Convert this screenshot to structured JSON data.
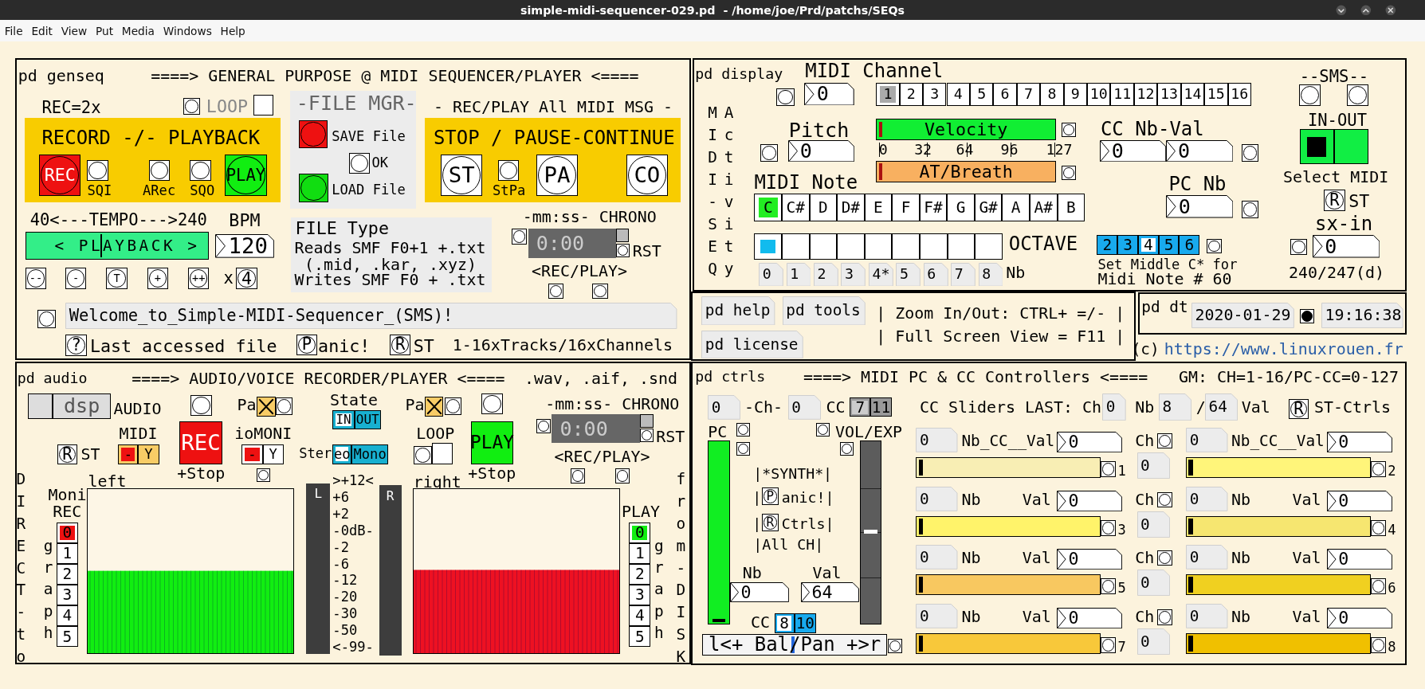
{
  "window": {
    "title": "simple-midi-sequencer-029.pd  - /home/joe/Prd/patchs/SEQs"
  },
  "menu": [
    "File",
    "Edit",
    "View",
    "Put",
    "Media",
    "Windows",
    "Help"
  ],
  "genseq": {
    "title": "pd genseq",
    "heading": "====> GENERAL PURPOSE @ MIDI SEQUENCER/PLAYER <====",
    "rec_mode": "REC=2x",
    "loop": {
      "label": "LOOP",
      "checked": false
    },
    "record_title": "RECORD -/- PLAYBACK",
    "rec_button": "REC",
    "sqi": "SQI",
    "arec": "ARec",
    "sqo": "SQO",
    "play_button": "PLAY",
    "file_mgr": "-FILE MGR-",
    "save": "SAVE File",
    "ok": "OK",
    "load": "LOAD File",
    "msg_heading": "- REC/PLAY All MIDI MSG -",
    "stop_title": "STOP / PAUSE-CONTINUE",
    "st": "ST",
    "stpa": "StPa",
    "pa": "PA",
    "co": "CO",
    "tempo_range": "40<---TEMPO--->240",
    "bpm_label": "BPM",
    "tempo_slider": {
      "label": "< PLAYBACK >",
      "level": 0.41
    },
    "bpm": "120",
    "tempo_buttons": [
      "--",
      "-",
      "T",
      "+",
      "++"
    ],
    "times": "x",
    "multiplier": "4",
    "file_type": "FILE Type",
    "file_lines": [
      "Reads SMF F0+1 +.txt",
      "(.mid, .kar, .xyz)",
      "Writes SMF F0 + .txt"
    ],
    "chrono": {
      "heading": "-mm:ss- CHRONO",
      "time": "0:00",
      "reset": "RST",
      "recplay": "<REC/PLAY>"
    },
    "message": "Welcome_to_Simple-MIDI-Sequencer_(SMS)!",
    "help_mark": "?",
    "last_file": "Last accessed file",
    "panic_mark": "P",
    "panic": "anic!",
    "reset_mark": "R",
    "reset": "ST",
    "tracks": "1-16xTracks/16xChannels"
  },
  "display": {
    "title": "pd display",
    "channel_label": "MIDI Channel",
    "channel_number": "0",
    "channels": [
      {
        "label": "1",
        "selected": true
      },
      {
        "label": "2",
        "selected": false
      },
      {
        "label": "3",
        "selected": false
      },
      {
        "label": "4",
        "selected": false
      },
      {
        "label": "5",
        "selected": false
      },
      {
        "label": "6",
        "selected": false
      },
      {
        "label": "7",
        "selected": false
      },
      {
        "label": "8",
        "selected": false
      },
      {
        "label": "9",
        "selected": false
      },
      {
        "label": "10",
        "selected": false
      },
      {
        "label": "11",
        "selected": false
      },
      {
        "label": "12",
        "selected": false
      },
      {
        "label": "13",
        "selected": false
      },
      {
        "label": "14",
        "selected": false
      },
      {
        "label": "15",
        "selected": false
      },
      {
        "label": "16",
        "selected": false
      }
    ],
    "sms": "--SMS--",
    "side1": "MIDI-SEQ",
    "side2": "Activity",
    "pitch_label": "Pitch",
    "pitch": "0",
    "velocity": {
      "label": "Velocity",
      "level": 0
    },
    "scale": [
      "0",
      "32",
      "64",
      "96",
      "127"
    ],
    "breath": {
      "label": "AT/Breath",
      "level": 0
    },
    "cc_label": "CC Nb-Val",
    "cc_nb": "0",
    "cc_val": "0",
    "note_label": "MIDI Note",
    "notes": [
      {
        "label": "C",
        "selected": true
      },
      {
        "label": "C#",
        "selected": false
      },
      {
        "label": "D",
        "selected": false
      },
      {
        "label": "D#",
        "selected": false
      },
      {
        "label": "E",
        "selected": false
      },
      {
        "label": "F",
        "selected": false
      },
      {
        "label": "F#",
        "selected": false
      },
      {
        "label": "G",
        "selected": false
      },
      {
        "label": "G#",
        "selected": false
      },
      {
        "label": "A",
        "selected": false
      },
      {
        "label": "A#",
        "selected": false
      },
      {
        "label": "B",
        "selected": false
      }
    ],
    "pc_label": "PC Nb",
    "pc": "0",
    "inout_label": "IN-OUT",
    "inout": [
      {
        "selected": true
      },
      {
        "selected": false
      }
    ],
    "select_midi": "Select MIDI",
    "st_mark": "R",
    "st": "ST",
    "sx_label": "sx-in",
    "sx": "0",
    "sx_note": "240/247(d)",
    "octaves": [
      {
        "selected": true
      },
      {
        "selected": false
      },
      {
        "selected": false
      },
      {
        "selected": false
      },
      {
        "selected": false
      },
      {
        "selected": false
      },
      {
        "selected": false
      },
      {
        "selected": false
      },
      {
        "selected": false
      }
    ],
    "octave_label": "OCTAVE",
    "octave_numbers": [
      "0",
      "1",
      "2",
      "3",
      "4*",
      "5",
      "6",
      "7",
      "8"
    ],
    "nb": "Nb",
    "middle": [
      {
        "label": "2",
        "selected": false
      },
      {
        "label": "3",
        "selected": false
      },
      {
        "label": "4",
        "selected": true
      },
      {
        "label": "5",
        "selected": false
      },
      {
        "label": "6",
        "selected": false
      }
    ],
    "middle_note": [
      "Set Middle C* for",
      "Midi Note # 60"
    ]
  },
  "help": {
    "buttons": [
      "pd help",
      "pd tools",
      "pd license"
    ],
    "lines": [
      "| Zoom In/Out: CTRL+ =/- |",
      "| Full Screen View = F11 |"
    ]
  },
  "dt": {
    "title": "pd dt",
    "date": "2020-01-29",
    "time": "19:16:38"
  },
  "copyright": "(c)",
  "link": "https://www.linuxrouen.fr",
  "audio": {
    "title": "pd audio",
    "heading": "====> AUDIO/VOICE RECORDER/PLAYER <====",
    "formats": ".wav, .aif, .snd",
    "dsp": {
      "label": "dsp",
      "checked": false
    },
    "audio_label": "AUDIO",
    "pause_in": {
      "label": "Pa",
      "checked": true
    },
    "state_label": "State",
    "state": [
      {
        "label": "IN",
        "selected": true
      },
      {
        "label": "OUT",
        "selected": false
      }
    ],
    "midi_label": "MIDI",
    "midi": [
      {
        "label": "-",
        "selected": true
      },
      {
        "label": "Y",
        "selected": false
      }
    ],
    "st_mark": "R",
    "st": "ST",
    "rec_button": "REC",
    "rec_stop": "+Stop",
    "iomoni_label": "ioMONI",
    "iomoni": [
      {
        "label": "-",
        "selected": true
      },
      {
        "label": "Y",
        "selected": false
      }
    ],
    "stereo_label": "Ster",
    "stereo": [
      {
        "label": "eo",
        "selected": true
      },
      {
        "label": "Mono",
        "selected": false
      }
    ],
    "pause_out": {
      "label": "Pa",
      "checked": true
    },
    "loop": {
      "label": "LOOP",
      "checked": false
    },
    "play_button": "PLAY",
    "play_stop": "+Stop",
    "chrono": {
      "heading": "-mm:ss- CHRONO",
      "time": "0:00",
      "reset": "RST",
      "recplay": "<REC/PLAY>"
    },
    "direct": "DIRECT-to",
    "graph_left": "graph",
    "moni": "Moni",
    "rec_label": "REC",
    "rec_graphs": [
      {
        "label": "0",
        "selected": true
      },
      {
        "label": "1",
        "selected": false
      },
      {
        "label": "2",
        "selected": false
      },
      {
        "label": "3",
        "selected": false
      },
      {
        "label": "4",
        "selected": false
      },
      {
        "label": "5",
        "selected": false
      }
    ],
    "left": "left",
    "vu_left": "L",
    "vu_scale": [
      ">+12<",
      "+6",
      "+2",
      "-0dB-",
      "-2",
      "-6",
      "-12",
      "-20",
      "-30",
      "-50",
      "<-99-"
    ],
    "vu_right": "R",
    "right": "right",
    "play_label": "PLAY",
    "play_graphs": [
      {
        "label": "0",
        "selected": true
      },
      {
        "label": "1",
        "selected": false
      },
      {
        "label": "2",
        "selected": false
      },
      {
        "label": "3",
        "selected": false
      },
      {
        "label": "4",
        "selected": false
      },
      {
        "label": "5",
        "selected": false
      }
    ],
    "graph_right": "graph",
    "disk": "from-DISK"
  },
  "ctrls": {
    "title": "pd ctrls",
    "heading": "====> MIDI PC & CC Controllers <====",
    "gm": "GM: CH=1-16/PC-CC=0-127",
    "pc_atom": "0",
    "ch_label": "-Ch-",
    "ch_atom": "0",
    "cc_label": "CC",
    "cc_pick": [
      {
        "label": "7",
        "selected": true
      },
      {
        "label": "11",
        "selected": false
      }
    ],
    "last_label": "CC Sliders LAST: Ch",
    "last_ch": "0",
    "nb_label": "Nb",
    "last_nb": "8",
    "slash": "/",
    "last_val": "64",
    "val_label": "Val",
    "st_mark": "R",
    "st": "ST-Ctrls",
    "pc_label": "PC",
    "vol_label": "VOL/EXP",
    "pc_slider": {
      "level": 0
    },
    "vol_slider": {
      "level": 0.5
    },
    "synth": "|*SYNTH*|",
    "panic_pre": "|",
    "panic_mark": "P",
    "panic": "anic!|",
    "ctrls_pre": "|",
    "ctrls_mark": "R",
    "ctrls": "Ctrls|",
    "all_ch": "|All CH|",
    "nb_label2": "Nb",
    "nb": "0",
    "val_label2": "Val",
    "val": "64",
    "cc2_label": "CC",
    "cc2_pick": [
      {
        "label": "8",
        "selected": true
      },
      {
        "label": "10",
        "selected": false
      }
    ],
    "balance": {
      "label": "l<+ Bal/Pan +>r",
      "level": 0.49
    },
    "sliders": [
      {
        "number": "0",
        "labels": [
          "Nb_CC__Val"
        ],
        "value": "0",
        "color": "#f8eeb4",
        "level": 0,
        "index": "1"
      },
      {
        "number": "0",
        "labels": [
          "Nb_CC__Val"
        ],
        "value": "0",
        "color": "#fff57a",
        "level": 0,
        "index": "2"
      },
      {
        "number": "0",
        "labels": [
          "Nb",
          "Val"
        ],
        "value": "0",
        "color": "#fff36a",
        "level": 0,
        "index": "3"
      },
      {
        "number": "0",
        "labels": [
          "Nb",
          "Val"
        ],
        "value": "0",
        "color": "#f6e670",
        "level": 0,
        "index": "4"
      },
      {
        "number": "0",
        "labels": [
          "Nb",
          "Val"
        ],
        "value": "0",
        "color": "#f8c860",
        "level": 0,
        "index": "5"
      },
      {
        "number": "0",
        "labels": [
          "Nb",
          "Val"
        ],
        "value": "0",
        "color": "#f0d020",
        "level": 0,
        "index": "6"
      },
      {
        "number": "0",
        "labels": [
          "Nb",
          "Val"
        ],
        "value": "0",
        "color": "#f8c83a",
        "level": 0,
        "index": "7"
      },
      {
        "number": "0",
        "labels": [
          "Nb",
          "Val"
        ],
        "value": "0",
        "color": "#f0c000",
        "level": 0,
        "index": "8"
      }
    ],
    "channels": [
      {
        "label": "Ch",
        "value": "0"
      },
      {
        "label": "Ch",
        "value": "0"
      },
      {
        "label": "Ch",
        "value": "0"
      },
      {
        "label": "Ch",
        "value": "0"
      }
    ]
  }
}
